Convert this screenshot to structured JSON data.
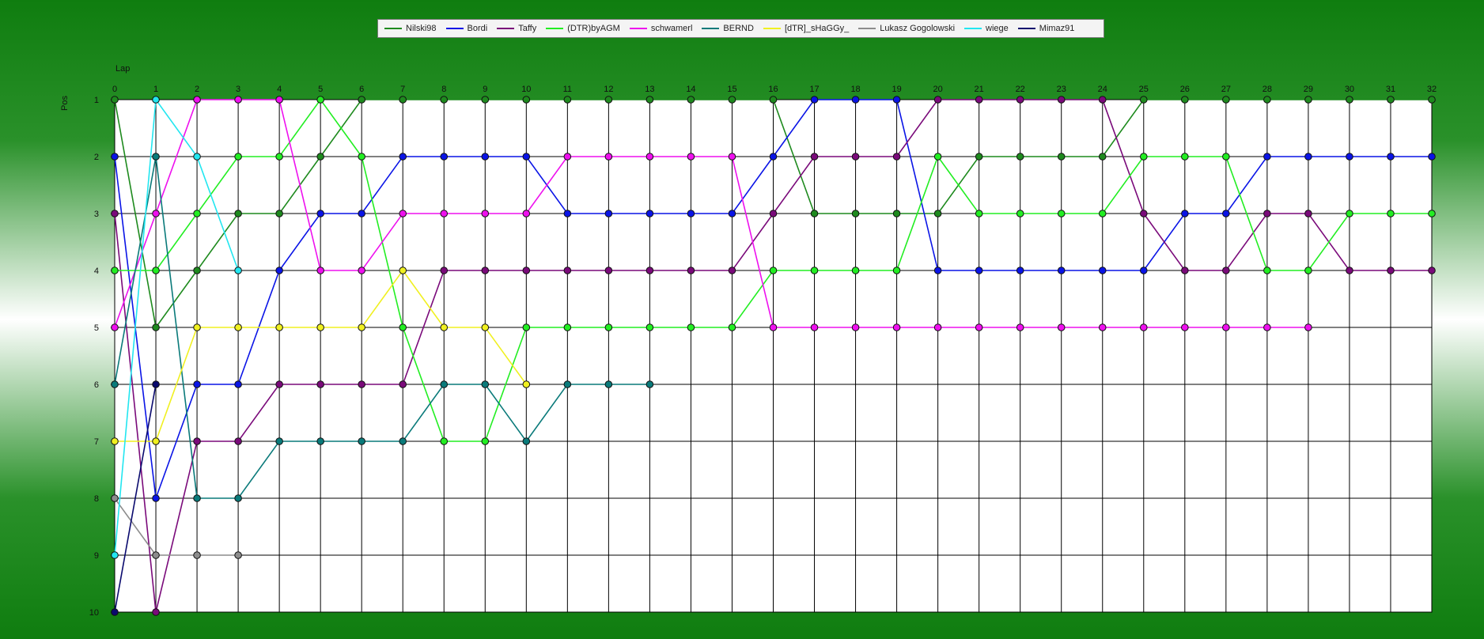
{
  "chart_data": {
    "type": "line",
    "xlabel": "Lap",
    "ylabel": "Pos",
    "x": [
      0,
      1,
      2,
      3,
      4,
      5,
      6,
      7,
      8,
      9,
      10,
      11,
      12,
      13,
      14,
      15,
      16,
      17,
      18,
      19,
      20,
      21,
      22,
      23,
      24,
      25,
      26,
      27,
      28,
      29,
      30,
      31,
      32
    ],
    "xlim": [
      0,
      32
    ],
    "ylim": [
      1,
      10
    ],
    "y_inverted": true,
    "grid": true,
    "legend_position": "top-center",
    "y_ticks": [
      "1",
      "2",
      "3",
      "4",
      "5",
      "6",
      "7",
      "8",
      "9",
      "10"
    ],
    "x_ticks": [
      "0",
      "1",
      "2",
      "3",
      "4",
      "5",
      "6",
      "7",
      "8",
      "9",
      "10",
      "11",
      "12",
      "13",
      "14",
      "15",
      "16",
      "17",
      "18",
      "19",
      "20",
      "21",
      "22",
      "23",
      "24",
      "25",
      "26",
      "27",
      "28",
      "29",
      "30",
      "31",
      "32"
    ],
    "series": [
      {
        "name": "Nilski98",
        "color": "#1e8a1e",
        "values": [
          1,
          5,
          4,
          3,
          3,
          2,
          1,
          1,
          1,
          1,
          1,
          1,
          1,
          1,
          1,
          1,
          1,
          3,
          3,
          3,
          3,
          2,
          2,
          2,
          2,
          1,
          1,
          1,
          1,
          1,
          1,
          1,
          1
        ]
      },
      {
        "name": "Bordi",
        "color": "#0a14e6",
        "values": [
          2,
          8,
          6,
          6,
          4,
          3,
          3,
          2,
          2,
          2,
          2,
          3,
          3,
          3,
          3,
          3,
          2,
          1,
          1,
          1,
          4,
          4,
          4,
          4,
          4,
          4,
          3,
          3,
          2,
          2,
          2,
          2,
          2
        ]
      },
      {
        "name": "Taffy",
        "color": "#7a0a7a",
        "values": [
          3,
          10,
          7,
          7,
          6,
          6,
          6,
          6,
          4,
          4,
          4,
          4,
          4,
          4,
          4,
          4,
          3,
          2,
          2,
          2,
          1,
          1,
          1,
          1,
          1,
          3,
          4,
          4,
          3,
          3,
          4,
          4,
          4
        ]
      },
      {
        "name": "(DTR)byAGM",
        "color": "#22ee22",
        "values": [
          4,
          4,
          3,
          2,
          2,
          1,
          2,
          5,
          7,
          7,
          5,
          5,
          5,
          5,
          5,
          5,
          4,
          4,
          4,
          4,
          2,
          3,
          3,
          3,
          3,
          2,
          2,
          2,
          4,
          4,
          3,
          3,
          3
        ]
      },
      {
        "name": "schwamerl",
        "color": "#ee10ee",
        "values": [
          5,
          3,
          1,
          1,
          1,
          4,
          4,
          3,
          3,
          3,
          3,
          2,
          2,
          2,
          2,
          2,
          5,
          5,
          5,
          5,
          5,
          5,
          5,
          5,
          5,
          5,
          5,
          5,
          5,
          5,
          null,
          null,
          null
        ]
      },
      {
        "name": "BERND",
        "color": "#0a7a7a",
        "values": [
          6,
          2,
          8,
          8,
          7,
          7,
          7,
          7,
          6,
          6,
          7,
          6,
          6,
          6,
          null,
          null,
          null,
          null,
          null,
          null,
          null,
          null,
          null,
          null,
          null,
          null,
          null,
          null,
          null,
          null,
          null,
          null,
          null
        ]
      },
      {
        "name": "[dTR]_sHaGGy_",
        "color": "#f0f020",
        "values": [
          7,
          7,
          5,
          5,
          5,
          5,
          5,
          4,
          5,
          5,
          6,
          null,
          null,
          null,
          null,
          null,
          null,
          null,
          null,
          null,
          null,
          null,
          null,
          null,
          null,
          null,
          null,
          null,
          null,
          null,
          null,
          null,
          null
        ]
      },
      {
        "name": "Lukasz Gogolowski",
        "color": "#8c8c8c",
        "values": [
          8,
          9,
          9,
          9,
          null,
          null,
          null,
          null,
          null,
          null,
          null,
          null,
          null,
          null,
          null,
          null,
          null,
          null,
          null,
          null,
          null,
          null,
          null,
          null,
          null,
          null,
          null,
          null,
          null,
          null,
          null,
          null,
          null
        ]
      },
      {
        "name": "wiege",
        "color": "#22e6f0",
        "values": [
          9,
          1,
          2,
          4,
          null,
          null,
          null,
          null,
          null,
          null,
          null,
          null,
          null,
          null,
          null,
          null,
          null,
          null,
          null,
          null,
          null,
          null,
          null,
          null,
          null,
          null,
          null,
          null,
          null,
          null,
          null,
          null,
          null
        ]
      },
      {
        "name": "Mimaz91",
        "color": "#0a0a6e",
        "values": [
          10,
          6,
          null,
          null,
          null,
          null,
          null,
          null,
          null,
          null,
          null,
          null,
          null,
          null,
          null,
          null,
          null,
          null,
          null,
          null,
          null,
          null,
          null,
          null,
          null,
          null,
          null,
          null,
          null,
          null,
          null,
          null,
          null
        ]
      }
    ]
  }
}
